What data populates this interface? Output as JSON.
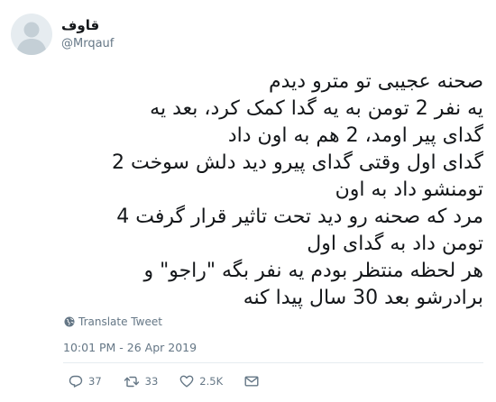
{
  "author": {
    "display_name": "قاوف",
    "handle": "@Mrqauf"
  },
  "tweet": {
    "lines": [
      "صحنه عجیبی تو مترو دیدم",
      "یه نفر 2 تومن به یه گدا کمک کرد، بعد یه",
      "گدای پیر اومد، 2 هم به اون داد",
      "گدای اول وقتی گدای پیرو دید دلش سوخت 2",
      "تومنشو داد به اون",
      "مرد که صحنه رو دید تحت تاثیر قرار گرفت 4",
      "تومن داد به گدای اول",
      "هر لحظه منتظر بودم یه نفر بگه \"راجو\" و",
      "برادرشو بعد 30 سال پیدا کنه"
    ],
    "translate_label": "Translate Tweet",
    "timestamp": "10:01 PM - 26 Apr 2019"
  },
  "actions": {
    "replies": "37",
    "retweets": "33",
    "likes": "2.5K"
  },
  "icons": {
    "avatar": "default-avatar-icon",
    "translate": "globe-icon",
    "reply": "reply-icon",
    "retweet": "retweet-icon",
    "like": "heart-icon",
    "more": "envelope-icon"
  },
  "colors": {
    "text": "#14171a",
    "secondary": "#657786",
    "divider": "#e6ecf0",
    "avatar_bg": "#e6ecf0",
    "avatar_fg": "#c4cfd6"
  }
}
